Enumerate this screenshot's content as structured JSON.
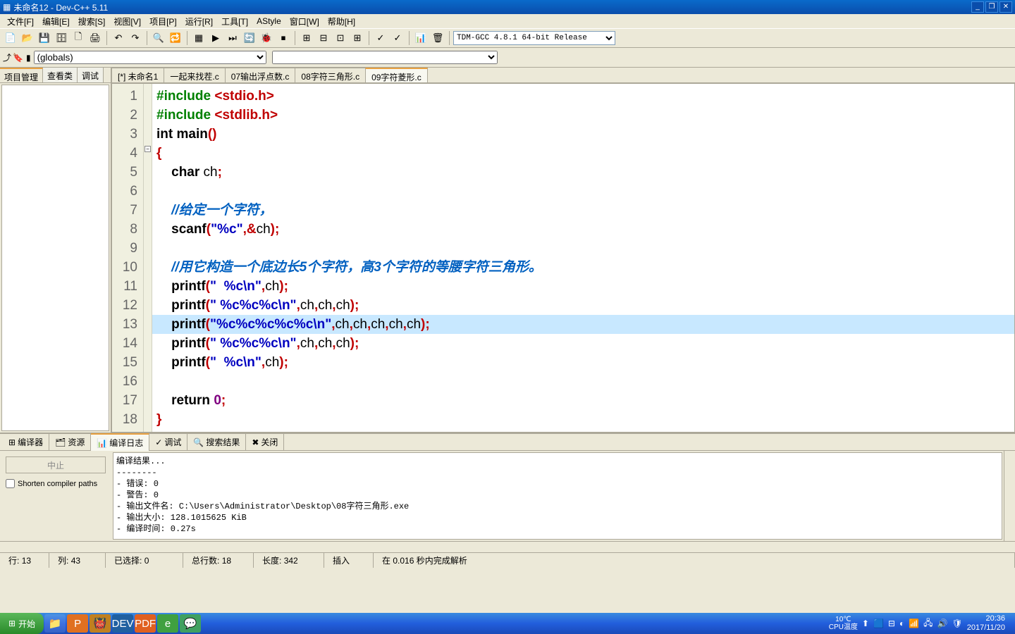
{
  "title": "未命名12 - Dev-C++ 5.11",
  "menus": [
    "文件[F]",
    "编辑[E]",
    "搜索[S]",
    "视图[V]",
    "项目[P]",
    "运行[R]",
    "工具[T]",
    "AStyle",
    "窗口[W]",
    "帮助[H]"
  ],
  "compiler_select": "TDM-GCC 4.8.1 64-bit Release",
  "scope_select": "(globals)",
  "side_tabs": [
    "项目管理",
    "查看类",
    "调试"
  ],
  "file_tabs": [
    "[*] 未命名1",
    "一起来找茬.c",
    "07输出浮点数.c",
    "08字符三角形.c",
    "09字符菱形.c"
  ],
  "active_file_tab": 4,
  "highlighted_line": 13,
  "code_lines": [
    {
      "n": 1,
      "tokens": [
        {
          "t": "pp",
          "v": "#include "
        },
        {
          "t": "inc",
          "v": "<stdio.h>"
        }
      ]
    },
    {
      "n": 2,
      "tokens": [
        {
          "t": "pp",
          "v": "#include "
        },
        {
          "t": "inc",
          "v": "<stdlib.h>"
        }
      ]
    },
    {
      "n": 3,
      "tokens": [
        {
          "t": "kw",
          "v": "int"
        },
        {
          "t": "",
          "v": " "
        },
        {
          "t": "fn",
          "v": "main"
        },
        {
          "t": "pn",
          "v": "()"
        }
      ]
    },
    {
      "n": 4,
      "tokens": [
        {
          "t": "pn",
          "v": "{"
        }
      ]
    },
    {
      "n": 5,
      "tokens": [
        {
          "t": "",
          "v": "    "
        },
        {
          "t": "kw",
          "v": "char"
        },
        {
          "t": "",
          "v": " ch"
        },
        {
          "t": "op",
          "v": ";"
        }
      ]
    },
    {
      "n": 6,
      "tokens": []
    },
    {
      "n": 7,
      "tokens": [
        {
          "t": "",
          "v": "    "
        },
        {
          "t": "cm",
          "v": "//给定一个字符，"
        }
      ]
    },
    {
      "n": 8,
      "tokens": [
        {
          "t": "",
          "v": "    "
        },
        {
          "t": "fn",
          "v": "scanf"
        },
        {
          "t": "pn",
          "v": "("
        },
        {
          "t": "str",
          "v": "\"%c\""
        },
        {
          "t": "op",
          "v": ",&"
        },
        {
          "t": "",
          "v": "ch"
        },
        {
          "t": "pn",
          "v": ")"
        },
        {
          "t": "op",
          "v": ";"
        }
      ]
    },
    {
      "n": 9,
      "tokens": []
    },
    {
      "n": 10,
      "tokens": [
        {
          "t": "",
          "v": "    "
        },
        {
          "t": "cm",
          "v": "//用它构造一个底边长5个字符，高3个字符的等腰字符三角形。"
        }
      ]
    },
    {
      "n": 11,
      "tokens": [
        {
          "t": "",
          "v": "    "
        },
        {
          "t": "fn",
          "v": "printf"
        },
        {
          "t": "pn",
          "v": "("
        },
        {
          "t": "str",
          "v": "\"  %c\\n\""
        },
        {
          "t": "op",
          "v": ","
        },
        {
          "t": "",
          "v": "ch"
        },
        {
          "t": "pn",
          "v": ")"
        },
        {
          "t": "op",
          "v": ";"
        }
      ]
    },
    {
      "n": 12,
      "tokens": [
        {
          "t": "",
          "v": "    "
        },
        {
          "t": "fn",
          "v": "printf"
        },
        {
          "t": "pn",
          "v": "("
        },
        {
          "t": "str",
          "v": "\" %c%c%c\\n\""
        },
        {
          "t": "op",
          "v": ","
        },
        {
          "t": "",
          "v": "ch"
        },
        {
          "t": "op",
          "v": ","
        },
        {
          "t": "",
          "v": "ch"
        },
        {
          "t": "op",
          "v": ","
        },
        {
          "t": "",
          "v": "ch"
        },
        {
          "t": "pn",
          "v": ")"
        },
        {
          "t": "op",
          "v": ";"
        }
      ]
    },
    {
      "n": 13,
      "tokens": [
        {
          "t": "",
          "v": "    "
        },
        {
          "t": "fn",
          "v": "printf"
        },
        {
          "t": "pn",
          "v": "("
        },
        {
          "t": "str",
          "v": "\"%c%c%c%c%c\\n\""
        },
        {
          "t": "op",
          "v": ","
        },
        {
          "t": "",
          "v": "ch"
        },
        {
          "t": "op",
          "v": ","
        },
        {
          "t": "",
          "v": "ch"
        },
        {
          "t": "op",
          "v": ","
        },
        {
          "t": "",
          "v": "ch"
        },
        {
          "t": "op",
          "v": ","
        },
        {
          "t": "",
          "v": "ch"
        },
        {
          "t": "op",
          "v": ","
        },
        {
          "t": "",
          "v": "ch"
        },
        {
          "t": "pn",
          "v": ")"
        },
        {
          "t": "op",
          "v": ";"
        }
      ]
    },
    {
      "n": 14,
      "tokens": [
        {
          "t": "",
          "v": "    "
        },
        {
          "t": "fn",
          "v": "printf"
        },
        {
          "t": "pn",
          "v": "("
        },
        {
          "t": "str",
          "v": "\" %c%c%c\\n\""
        },
        {
          "t": "op",
          "v": ","
        },
        {
          "t": "",
          "v": "ch"
        },
        {
          "t": "op",
          "v": ","
        },
        {
          "t": "",
          "v": "ch"
        },
        {
          "t": "op",
          "v": ","
        },
        {
          "t": "",
          "v": "ch"
        },
        {
          "t": "pn",
          "v": ")"
        },
        {
          "t": "op",
          "v": ";"
        }
      ]
    },
    {
      "n": 15,
      "tokens": [
        {
          "t": "",
          "v": "    "
        },
        {
          "t": "fn",
          "v": "printf"
        },
        {
          "t": "pn",
          "v": "("
        },
        {
          "t": "str",
          "v": "\"  %c\\n\""
        },
        {
          "t": "op",
          "v": ","
        },
        {
          "t": "",
          "v": "ch"
        },
        {
          "t": "pn",
          "v": ")"
        },
        {
          "t": "op",
          "v": ";"
        }
      ]
    },
    {
      "n": 16,
      "tokens": []
    },
    {
      "n": 17,
      "tokens": [
        {
          "t": "",
          "v": "    "
        },
        {
          "t": "kw",
          "v": "return"
        },
        {
          "t": "",
          "v": " "
        },
        {
          "t": "num",
          "v": "0"
        },
        {
          "t": "op",
          "v": ";"
        }
      ]
    },
    {
      "n": 18,
      "tokens": [
        {
          "t": "pn",
          "v": "}"
        }
      ]
    }
  ],
  "bottom_tabs": [
    {
      "icon": "⊞",
      "label": "编译器"
    },
    {
      "icon": "🗂",
      "label": "资源"
    },
    {
      "icon": "📊",
      "label": "编译日志"
    },
    {
      "icon": "✓",
      "label": "调试"
    },
    {
      "icon": "🔍",
      "label": "搜索结果"
    },
    {
      "icon": "✖",
      "label": "关闭"
    }
  ],
  "active_bottom_tab": 2,
  "abort_btn": "中止",
  "shorten_label": "Shorten compiler paths",
  "compile_output": "编译结果...\n--------\n- 错误: 0\n- 警告: 0\n- 输出文件名: C:\\Users\\Administrator\\Desktop\\08字符三角形.exe\n- 输出大小: 128.1015625 KiB\n- 编译时间: 0.27s",
  "status": {
    "line_lbl": "行:",
    "line": "13",
    "col_lbl": "列:",
    "col": "43",
    "sel_lbl": "已选择:",
    "sel": "0",
    "tot_lbl": "总行数:",
    "tot": "18",
    "len_lbl": "长度:",
    "len": "342",
    "mode": "插入",
    "parse": "在 0.016 秒内完成解析"
  },
  "start_label": "开始",
  "tray_temp": "10℃\nCPU温度",
  "clock_time": "20:36",
  "clock_date": "2017/11/20"
}
